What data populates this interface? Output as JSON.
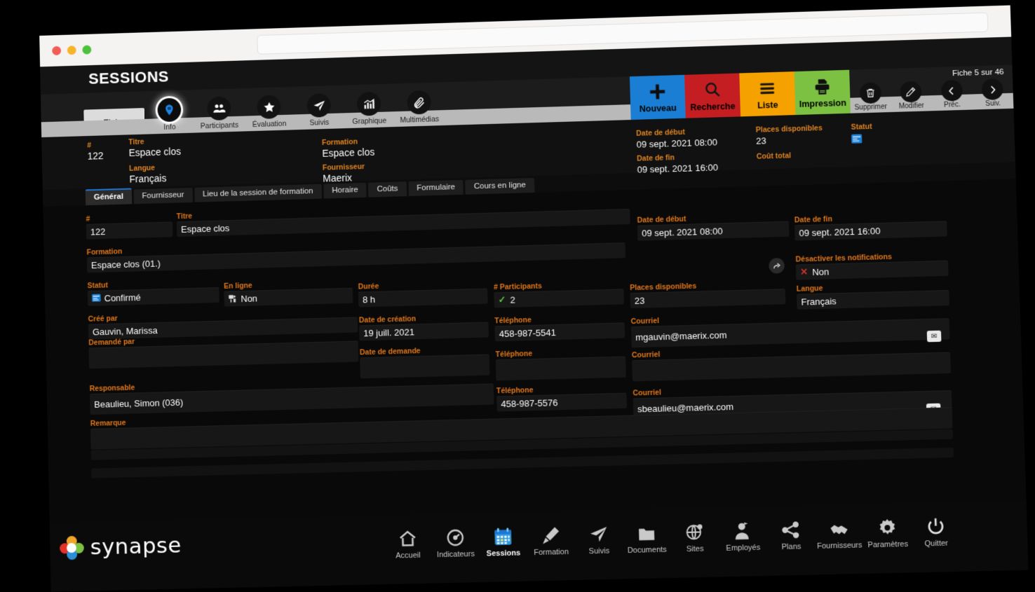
{
  "window": {
    "traffic_lights": [
      "close",
      "minimize",
      "maximize"
    ],
    "url_value": "",
    "url_placeholder": ""
  },
  "header": {
    "app_title": "SESSIONS",
    "record_counter": "Fiche 5 sur 46"
  },
  "ribbon": {
    "fiche_tab": "Fiche",
    "items": [
      {
        "label": "Info",
        "icon": "info-pin-icon",
        "active": true
      },
      {
        "label": "Participants",
        "icon": "people-icon",
        "active": false
      },
      {
        "label": "Évaluation",
        "icon": "star-icon",
        "active": false
      },
      {
        "label": "Suivis",
        "icon": "paper-plane-icon",
        "active": false
      },
      {
        "label": "Graphique",
        "icon": "bar-chart-icon",
        "active": false
      },
      {
        "label": "Multimédias",
        "icon": "paperclip-icon",
        "active": false
      }
    ],
    "actions": [
      {
        "label": "Nouveau",
        "icon": "plus-icon",
        "color": "#1a7fd4"
      },
      {
        "label": "Recherche",
        "icon": "magnifier-icon",
        "color": "#c41e22"
      },
      {
        "label": "Liste",
        "icon": "list-icon",
        "color": "#f5a200"
      },
      {
        "label": "Impression",
        "icon": "printer-icon",
        "color": "#7cc142"
      }
    ],
    "record_nav": [
      {
        "label": "Supprimer",
        "icon": "trash-icon"
      },
      {
        "label": "Modifier",
        "icon": "pencil-icon"
      },
      {
        "label": "Préc.",
        "icon": "chevron-left-icon"
      },
      {
        "label": "Suiv.",
        "icon": "chevron-right-icon"
      }
    ]
  },
  "summary": {
    "num_label": "#",
    "num_value": "122",
    "titre_label": "Titre",
    "titre_value": "Espace clos",
    "langue_label": "Langue",
    "langue_value": "Français",
    "formation_label": "Formation",
    "formation_value": "Espace clos",
    "fournisseur_label": "Fournisseur",
    "fournisseur_value": "Maerix",
    "date_debut_label": "Date de début",
    "date_debut_value": "09 sept. 2021 08:00",
    "date_fin_label": "Date de fin",
    "date_fin_value": "09 sept. 2021 16:00",
    "places_label": "Places disponibles",
    "places_value": "23",
    "cout_label": "Coût total",
    "cout_value": "",
    "statut_label": "Statut",
    "statut_icon": "status-badge-icon"
  },
  "tabs": [
    {
      "label": "Général",
      "active": true
    },
    {
      "label": "Fournisseur",
      "active": false
    },
    {
      "label": "Lieu de la session de formation",
      "active": false
    },
    {
      "label": "Horaire",
      "active": false
    },
    {
      "label": "Coûts",
      "active": false
    },
    {
      "label": "Formulaire",
      "active": false
    },
    {
      "label": "Cours en ligne",
      "active": false
    }
  ],
  "form": {
    "num": {
      "label": "#",
      "value": "122"
    },
    "titre": {
      "label": "Titre",
      "value": "Espace clos"
    },
    "date_debut": {
      "label": "Date de début",
      "value": "09 sept. 2021 08:00"
    },
    "date_fin": {
      "label": "Date de fin",
      "value": "09 sept. 2021 16:00"
    },
    "formation": {
      "label": "Formation",
      "value": "Espace clos (01.)"
    },
    "desactiver": {
      "label": "Désactiver les notifications",
      "value": "Non"
    },
    "statut": {
      "label": "Statut",
      "value": "Confirmé"
    },
    "en_ligne": {
      "label": "En ligne",
      "value": "Non"
    },
    "duree": {
      "label": "Durée",
      "value": "8 h"
    },
    "participants": {
      "label": "# Participants",
      "value": "2"
    },
    "places": {
      "label": "Places disponibles",
      "value": "23"
    },
    "langue": {
      "label": "Langue",
      "value": "Français"
    },
    "cree_par": {
      "label": "Créé par",
      "value": "Gauvin, Marissa"
    },
    "date_creation": {
      "label": "Date de création",
      "value": "19 juill. 2021"
    },
    "tel_cree": {
      "label": "Téléphone",
      "value": "458-987-5541"
    },
    "courriel_cree": {
      "label": "Courriel",
      "value": "mgauvin@maerix.com"
    },
    "demande_par": {
      "label": "Demandé par",
      "value": ""
    },
    "date_demande": {
      "label": "Date de demande",
      "value": ""
    },
    "tel_demande": {
      "label": "Téléphone",
      "value": ""
    },
    "courriel_demande": {
      "label": "Courriel",
      "value": ""
    },
    "responsable": {
      "label": "Responsable",
      "value": "Beaulieu, Simon (036)"
    },
    "tel_resp": {
      "label": "Téléphone",
      "value": "458-987-5576"
    },
    "courriel_resp": {
      "label": "Courriel",
      "value": "sbeaulieu@maerix.com"
    },
    "remarque": {
      "label": "Remarque",
      "value": ""
    }
  },
  "footer": {
    "logo_text": "synapse",
    "nav": [
      {
        "label": "Accueil",
        "icon": "home-icon",
        "active": false
      },
      {
        "label": "Indicateurs",
        "icon": "gauge-icon",
        "active": false
      },
      {
        "label": "Sessions",
        "icon": "calendar-icon",
        "active": true
      },
      {
        "label": "Formation",
        "icon": "pencil-diagonal-icon",
        "active": false
      },
      {
        "label": "Suivis",
        "icon": "paper-plane-icon",
        "active": false
      },
      {
        "label": "Documents",
        "icon": "folder-icon",
        "active": false
      },
      {
        "label": "Sites",
        "icon": "globe-pin-icon",
        "active": false
      },
      {
        "label": "Employés",
        "icon": "person-icon",
        "active": false
      },
      {
        "label": "Plans",
        "icon": "share-nodes-icon",
        "active": false
      },
      {
        "label": "Fournisseurs",
        "icon": "handshake-icon",
        "active": false
      },
      {
        "label": "Paramètres",
        "icon": "gear-icon",
        "active": false
      },
      {
        "label": "Quitter",
        "icon": "power-icon",
        "active": false
      }
    ]
  },
  "colors": {
    "accent_orange": "#e0771b",
    "blue": "#1a7fd4",
    "red": "#c41e22",
    "amber": "#f5a200",
    "green": "#7cc142"
  }
}
